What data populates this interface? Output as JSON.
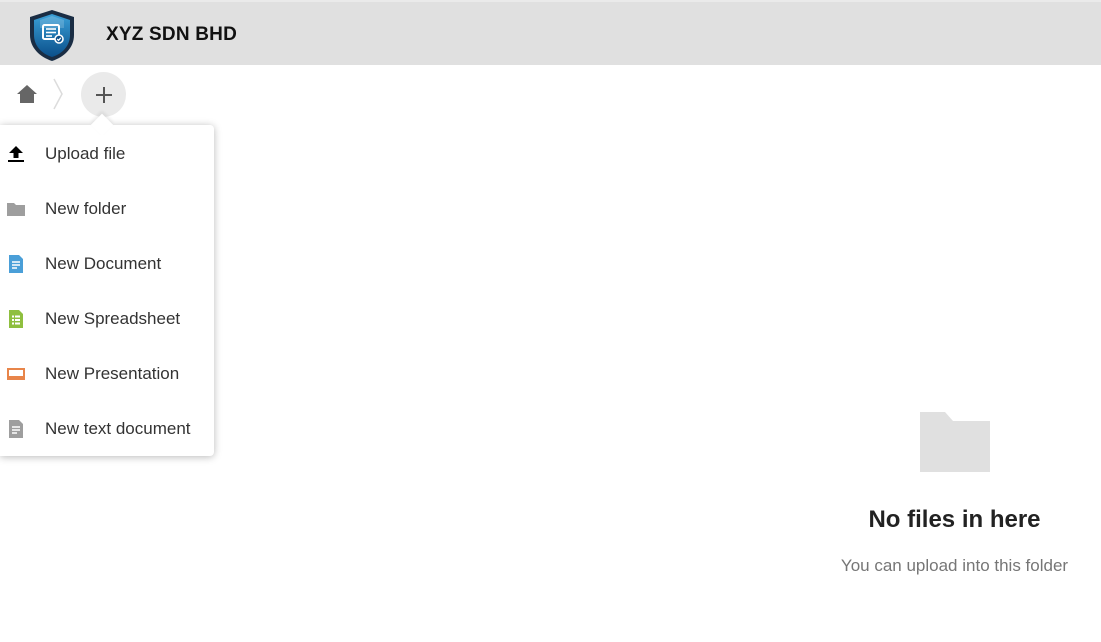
{
  "header": {
    "title": "XYZ SDN BHD",
    "logo_icon": "shield-logo-icon"
  },
  "breadcrumb": {
    "home_icon": "home-icon",
    "add_icon": "plus-icon"
  },
  "new_menu": {
    "items": [
      {
        "label": "Upload file",
        "icon": "upload-icon",
        "color": "#000000"
      },
      {
        "label": "New folder",
        "icon": "folder-icon",
        "color": "#9e9e9e"
      },
      {
        "label": "New Document",
        "icon": "document-icon",
        "color": "#4a9fd8"
      },
      {
        "label": "New Spreadsheet",
        "icon": "spreadsheet-icon",
        "color": "#8fbf3f"
      },
      {
        "label": "New Presentation",
        "icon": "presentation-icon",
        "color": "#e8854a"
      },
      {
        "label": "New text document",
        "icon": "text-document-icon",
        "color": "#9e9e9e"
      }
    ]
  },
  "empty_state": {
    "title": "No files in here",
    "subtitle": "You can upload into this folder",
    "icon": "folder-icon"
  },
  "colors": {
    "header_bg": "#e0e0e0",
    "add_button_bg": "#eaeaea"
  }
}
